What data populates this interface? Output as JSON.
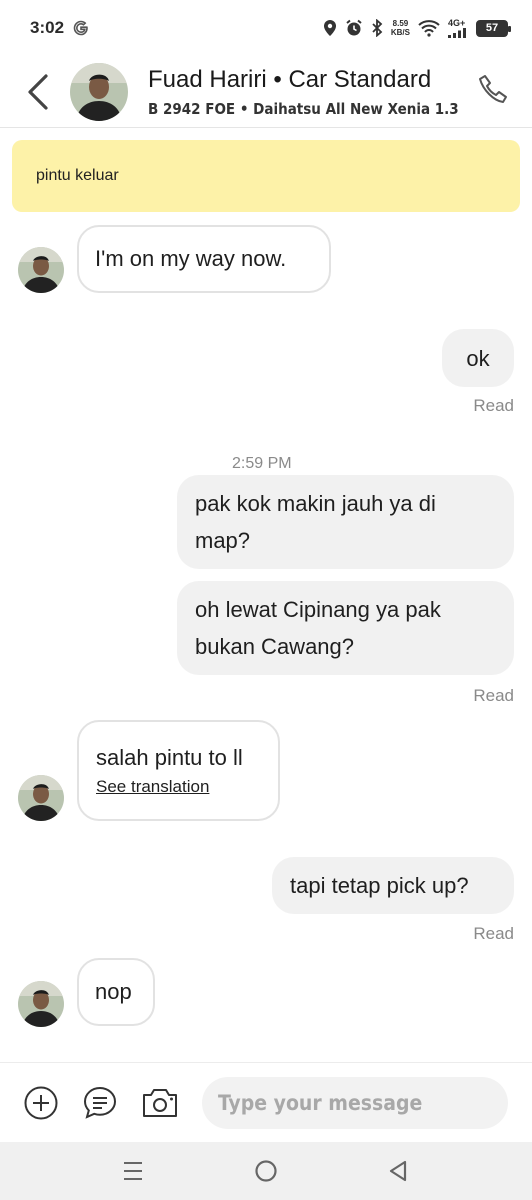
{
  "status_bar": {
    "time": "3:02",
    "net_speed_value": "8.59",
    "net_speed_unit": "KB/S",
    "net_type": "4G+",
    "battery": "57"
  },
  "header": {
    "driver_title": "Fuad Hariri • Car Standard",
    "vehicle_info": "B 2942 FOE • Daihatsu All New Xenia 1.3"
  },
  "notice": {
    "text": "pintu keluar"
  },
  "messages": [
    {
      "direction": "incoming",
      "text": "I'm on my way now."
    },
    {
      "direction": "outgoing",
      "text": "ok",
      "status": "Read"
    },
    {
      "timestamp": "2:59 PM"
    },
    {
      "direction": "outgoing",
      "text": "pak kok makin jauh ya di map?"
    },
    {
      "direction": "outgoing",
      "text": "oh lewat Cipinang ya pak bukan Cawang?",
      "status": "Read"
    },
    {
      "direction": "incoming",
      "text": "salah pintu to ll",
      "action": "See translation"
    },
    {
      "direction": "outgoing",
      "text": "tapi tetap pick up?",
      "status": "Read"
    },
    {
      "direction": "incoming",
      "text": "nop"
    }
  ],
  "composer": {
    "placeholder": "Type your message"
  },
  "icons": {
    "back": "chevron-left-icon",
    "phone": "phone-icon",
    "add": "plus-circle-icon",
    "templates": "chat-bubble-icon",
    "camera": "camera-icon",
    "nav_recents": "menu-lines-icon",
    "nav_home": "circle-icon",
    "nav_back": "triangle-back-icon"
  },
  "colors": {
    "notice_bg": "#fdf2a8",
    "outgoing_bubble": "#f1f1f1",
    "incoming_border": "#e2e2e2"
  }
}
